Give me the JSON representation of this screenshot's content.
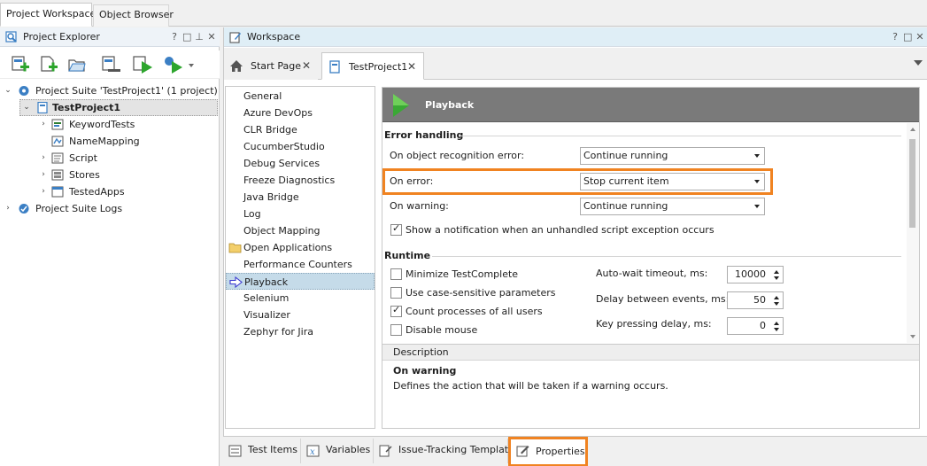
{
  "top_tabs": {
    "project_workspace": "Project Workspace",
    "object_browser": "Object Browser"
  },
  "explorer": {
    "title": "Project Explorer",
    "controls": {
      "help": "?",
      "float": "□",
      "pin": "⊥",
      "close": "✕"
    },
    "tree": [
      {
        "label": "Project Suite 'TestProject1' (1 project)",
        "icon": "project-suite-icon"
      },
      {
        "label": "TestProject1",
        "icon": "project-icon"
      },
      {
        "label": "KeywordTests",
        "icon": "keyword-tests-icon"
      },
      {
        "label": "NameMapping",
        "icon": "name-mapping-icon"
      },
      {
        "label": "Script",
        "icon": "script-icon"
      },
      {
        "label": "Stores",
        "icon": "stores-icon"
      },
      {
        "label": "TestedApps",
        "icon": "tested-apps-icon"
      },
      {
        "label": "Project Suite Logs",
        "icon": "logs-icon"
      }
    ]
  },
  "workspace": {
    "title": "Workspace",
    "controls": {
      "help": "?",
      "float": "□",
      "close": "✕"
    },
    "tabs": [
      {
        "label": "Start Page",
        "close": "✕"
      },
      {
        "label": "TestProject1",
        "close": "✕"
      }
    ],
    "nav": [
      "General",
      "Azure DevOps",
      "CLR Bridge",
      "CucumberStudio",
      "Debug Services",
      "Freeze Diagnostics",
      "Java Bridge",
      "Log",
      "Object Mapping",
      "Open Applications",
      "Performance Counters",
      "Playback",
      "Selenium",
      "Visualizer",
      "Zephyr for Jira"
    ],
    "panel": {
      "banner_title": "Playback",
      "error_handling": {
        "heading": "Error handling",
        "object_recognition_label": "On object recognition error:",
        "object_recognition_value": "Continue running",
        "on_error_label": "On error:",
        "on_error_value": "Stop current item",
        "on_warning_label": "On warning:",
        "on_warning_value": "Continue running",
        "show_notification_label": "Show a notification when an unhandled script exception occurs",
        "show_notification_checked": true
      },
      "runtime": {
        "heading": "Runtime",
        "checkboxes": [
          {
            "label": "Minimize TestComplete",
            "checked": false
          },
          {
            "label": "Use case-sensitive parameters",
            "checked": false
          },
          {
            "label": "Count processes of all users",
            "checked": true
          },
          {
            "label": "Disable mouse",
            "checked": false
          }
        ],
        "spinners": [
          {
            "label": "Auto-wait timeout, ms:",
            "value": "10000"
          },
          {
            "label": "Delay between events, ms:",
            "value": "50"
          },
          {
            "label": "Key pressing delay, ms:",
            "value": "0"
          }
        ]
      },
      "description": {
        "heading": "Description",
        "title": "On warning",
        "text": "Defines the action that will be taken if a warning occurs."
      }
    }
  },
  "bottom_tabs": [
    "Test Items",
    "Variables",
    "Issue-Tracking Templates",
    "Properties"
  ],
  "colors": {
    "highlight": "#f08321",
    "banner": "#7a7a7a",
    "playback_green": "#3aa935",
    "selection": "#c5dbe9"
  }
}
